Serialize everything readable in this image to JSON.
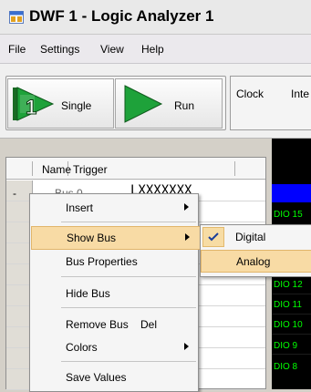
{
  "window": {
    "title": "DWF 1 - Logic Analyzer 1",
    "icon": "app-window-icon"
  },
  "menubar": {
    "items": [
      "File",
      "Settings",
      "View",
      "Help"
    ]
  },
  "toolbar": {
    "single_label": "Single",
    "run_label": "Run",
    "clock_label": "Clock",
    "clock_value": "Inte"
  },
  "grid": {
    "headers": [
      "Name",
      "Trigger"
    ],
    "rows": [
      {
        "marker": "-",
        "name": "Bus 0",
        "trigger": "LXXXXXXX"
      }
    ]
  },
  "signals": [
    "DIO 15",
    "DIO 12",
    "DIO 11",
    "DIO 10",
    "DIO 9",
    "DIO 8"
  ],
  "context_menu": {
    "items": [
      {
        "label": "Insert",
        "submenu": true
      },
      {
        "label": "Show Bus",
        "submenu": true,
        "highlighted": true
      },
      {
        "label": "Bus Properties"
      },
      {
        "label": "Hide Bus"
      },
      {
        "label": "Remove Bus",
        "shortcut": "Del"
      },
      {
        "label": "Colors",
        "submenu": true
      },
      {
        "label": "Save Values"
      }
    ]
  },
  "submenu": {
    "items": [
      {
        "label": "Digital",
        "checked": true
      },
      {
        "label": "Analog",
        "highlighted": true
      }
    ]
  },
  "colors": {
    "menu_highlight": "#f8dba5",
    "signal_text": "#00ff00",
    "signal_bg": "#000000",
    "bus_band": "#0000ff"
  }
}
